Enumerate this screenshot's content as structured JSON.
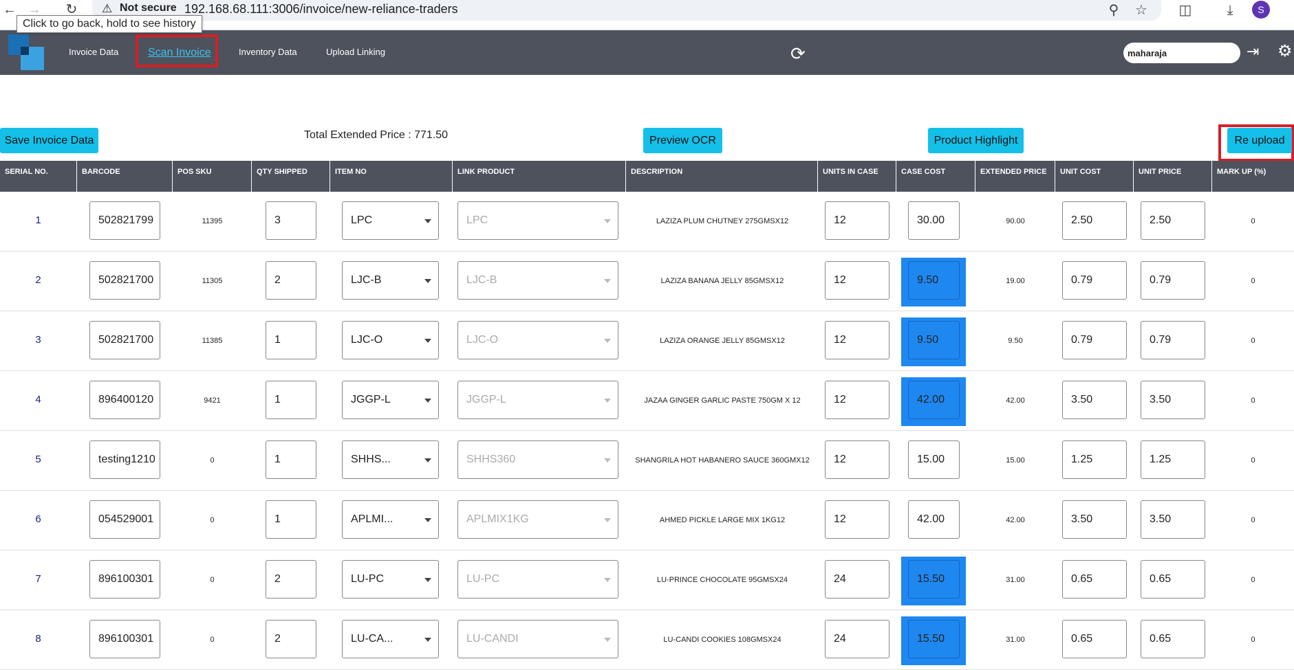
{
  "browser": {
    "security_label": "Not secure",
    "url": "192.168.68.111:3006/invoice/new-reliance-traders",
    "tooltip": "Click to go back, hold to see history",
    "avatar_letter": "S"
  },
  "nav": {
    "items": [
      "Invoice Data",
      "Scan Invoice",
      "Inventory Data",
      "Upload Linking"
    ],
    "active": "Scan Invoice",
    "user_value": "maharaja"
  },
  "toolbar": {
    "save_label": "Save Invoice Data",
    "total_label": "Total Extended Price : 771.50",
    "preview_label": "Preview OCR",
    "highlight_label": "Product Highlight",
    "reupload_label": "Re upload"
  },
  "table": {
    "columns": [
      "SERIAL NO.",
      "BARCODE",
      "POS SKU",
      "QTY SHIPPED",
      "ITEM NO",
      "LINK PRODUCT",
      "DESCRIPTION",
      "UNITS IN CASE",
      "CASE COST",
      "EXTENDED PRICE",
      "UNIT COST",
      "UNIT PRICE",
      "MARK UP (%)"
    ],
    "rows": [
      {
        "serial": "1",
        "barcode": "502821799",
        "pos_sku": "11395",
        "qty": "3",
        "item_no": "LPC",
        "link": "LPC",
        "description": "LAZIZA PLUM CHUTNEY 275GMSX12",
        "units": "12",
        "case_cost": "30.00",
        "case_highlight": false,
        "extended": "90.00",
        "unit_cost": "2.50",
        "unit_price": "2.50",
        "markup": "0"
      },
      {
        "serial": "2",
        "barcode": "502821700",
        "pos_sku": "11305",
        "qty": "2",
        "item_no": "LJC-B",
        "link": "LJC-B",
        "description": "LAZIZA BANANA JELLY 85GMSX12",
        "units": "12",
        "case_cost": "9.50",
        "case_highlight": true,
        "extended": "19.00",
        "unit_cost": "0.79",
        "unit_price": "0.79",
        "markup": "0"
      },
      {
        "serial": "3",
        "barcode": "502821700",
        "pos_sku": "11385",
        "qty": "1",
        "item_no": "LJC-O",
        "link": "LJC-O",
        "description": "LAZIZA ORANGE JELLY 85GMSX12",
        "units": "12",
        "case_cost": "9.50",
        "case_highlight": true,
        "extended": "9.50",
        "unit_cost": "0.79",
        "unit_price": "0.79",
        "markup": "0"
      },
      {
        "serial": "4",
        "barcode": "896400120",
        "pos_sku": "9421",
        "qty": "1",
        "item_no": "JGGP-L",
        "link": "JGGP-L",
        "description": "JAZAA GINGER GARLIC PASTE 750GM X 12",
        "units": "12",
        "case_cost": "42.00",
        "case_highlight": true,
        "extended": "42.00",
        "unit_cost": "3.50",
        "unit_price": "3.50",
        "markup": "0"
      },
      {
        "serial": "5",
        "barcode": "testing1210",
        "pos_sku": "0",
        "qty": "1",
        "item_no": "SHHS...",
        "link": "SHHS360",
        "description": "SHANGRILA HOT HABANERO SAUCE 360GMX12",
        "units": "12",
        "case_cost": "15.00",
        "case_highlight": false,
        "extended": "15.00",
        "unit_cost": "1.25",
        "unit_price": "1.25",
        "markup": "0"
      },
      {
        "serial": "6",
        "barcode": "054529001",
        "pos_sku": "0",
        "qty": "1",
        "item_no": "APLMI...",
        "link": "APLMIX1KG",
        "description": "AHMED PICKLE LARGE MIX 1KG12",
        "units": "12",
        "case_cost": "42.00",
        "case_highlight": false,
        "extended": "42.00",
        "unit_cost": "3.50",
        "unit_price": "3.50",
        "markup": "0"
      },
      {
        "serial": "7",
        "barcode": "896100301",
        "pos_sku": "0",
        "qty": "2",
        "item_no": "LU-PC",
        "link": "LU-PC",
        "description": "LU-PRINCE CHOCOLATE 95GMSX24",
        "units": "24",
        "case_cost": "15.50",
        "case_highlight": true,
        "extended": "31.00",
        "unit_cost": "0.65",
        "unit_price": "0.65",
        "markup": "0"
      },
      {
        "serial": "8",
        "barcode": "896100301",
        "pos_sku": "0",
        "qty": "2",
        "item_no": "LU-CA...",
        "link": "LU-CANDI",
        "description": "LU-CANDI COOKIES 108GMSX24",
        "units": "24",
        "case_cost": "15.50",
        "case_highlight": true,
        "extended": "31.00",
        "unit_cost": "0.65",
        "unit_price": "0.65",
        "markup": "0"
      }
    ]
  },
  "colors": {
    "header_bg": "#4d525d",
    "button_bg": "#14c0e8",
    "highlight_blue": "#1e88f0",
    "red_outline": "#d32027"
  }
}
